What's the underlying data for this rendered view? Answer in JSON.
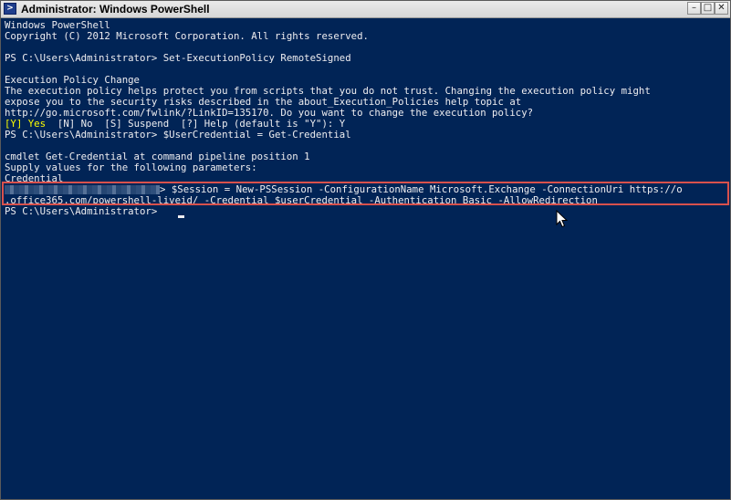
{
  "window": {
    "title": "Administrator: Windows PowerShell",
    "controls": {
      "minimize": "–",
      "maximize": "□",
      "close": "✕"
    }
  },
  "console": {
    "line1": "Windows PowerShell",
    "line2": "Copyright (C) 2012 Microsoft Corporation. All rights reserved.",
    "line3": "PS C:\\Users\\Administrator> Set-ExecutionPolicy RemoteSigned",
    "line4": "Execution Policy Change",
    "line5": "The execution policy helps protect you from scripts that you do not trust. Changing the execution policy might",
    "line6": "expose you to the security risks described in the about_Execution_Policies help topic at",
    "line7": "http://go.microsoft.com/fwlink/?LinkID=135170. Do you want to change the execution policy?",
    "line8_highlight": "[Y] Yes",
    "line8_rest": "  [N] No  [S] Suspend  [?] Help (default is \"Y\"): Y",
    "line9": "PS C:\\Users\\Administrator> $UserCredential = Get-Credential",
    "line10": "cmdlet Get-Credential at command pipeline position 1",
    "line11": "Supply values for the following parameters:",
    "line12": "Credential",
    "line13_cmd": "> $Session = New-PSSession -ConfigurationName Microsoft.Exchange -ConnectionUri https://o",
    "line14": ".office365.com/powershell-liveid/ -Credential $userCredential -Authentication Basic -AllowRedirection",
    "line15": "PS C:\\Users\\Administrator> "
  },
  "colors": {
    "background": "#012456",
    "text": "#eeedf0",
    "prompt_highlight": "#ffff00",
    "annotation_border": "#d9514c"
  },
  "icons": {
    "app": "powershell-icon",
    "pointer": "mouse-pointer-icon"
  }
}
